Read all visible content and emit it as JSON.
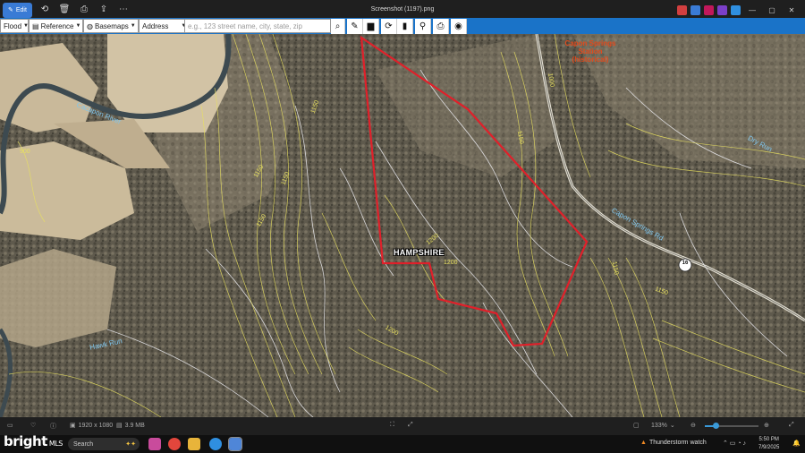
{
  "window": {
    "title": "Screenshot (1197).png",
    "edit_label": "Edit"
  },
  "map_toolbar": {
    "flood_label": "Flood",
    "reference_label": "Reference",
    "basemaps_label": "Basemaps",
    "address_label": "Address",
    "address_placeholder": "e.g., 123 street name, city, state, zip"
  },
  "map": {
    "labels": {
      "station": "Capon Springs\nStation\n(historical)",
      "county": "HAMPSHIRE",
      "road_number": "16",
      "creek_upper": "Dry Run",
      "river_left": "Cacapon River",
      "stream_lower_left": "Hawk Run",
      "road_name": "Capon Springs Rd",
      "contours": [
        "900",
        "1150",
        "1150",
        "1150",
        "1000",
        "1150",
        "1150",
        "1200",
        "1200",
        "1200",
        "1150",
        "1150"
      ]
    }
  },
  "statusbar": {
    "dimensions": "1920 x 1080",
    "filesize": "3.9 MB",
    "zoom": "133%"
  },
  "taskbar": {
    "search_label": "Search",
    "weather": "Thunderstorm watch",
    "time": "5:50 PM",
    "date": "7/9/2025",
    "watermark": "bright",
    "watermark_suffix": "MLS"
  },
  "colors": {
    "toolbar_blue": "#1a73c8",
    "boundary_red": "#e0202a",
    "contour_yellow": "#e8e060"
  }
}
